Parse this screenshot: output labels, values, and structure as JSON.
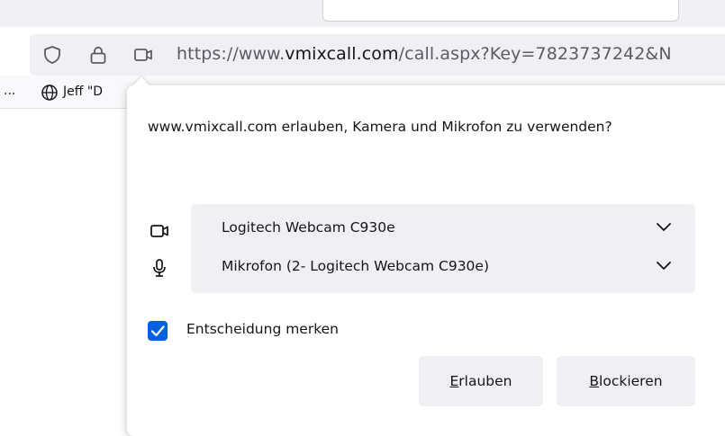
{
  "toolbar": {
    "url_prefix": "https://www.",
    "url_domain": "vmixcall.com",
    "url_suffix": "/call.aspx?Key=7823737242&N"
  },
  "bookmarks": {
    "overflow": "...",
    "item_label": "Jeff \"D"
  },
  "dialog": {
    "question": "www.vmixcall.com erlauben, Kamera und Mikrofon zu verwenden?",
    "camera_select": {
      "value": "Logitech Webcam C930e"
    },
    "microphone_select": {
      "value": "Mikrofon (2- Logitech Webcam C930e)"
    },
    "remember": {
      "label": "Entscheidung merken",
      "checked": true
    },
    "allow_button": {
      "mnemonic": "E",
      "rest": "rlauben"
    },
    "block_button": {
      "mnemonic": "B",
      "rest": "lockieren"
    }
  },
  "icons": {
    "tracking": "shield-icon",
    "secure": "lock-icon",
    "permission": "camera-icon",
    "bookmark": "globe-icon",
    "camera_device": "camera-icon",
    "mic_device": "microphone-icon",
    "dropdown": "chevron-down-icon"
  },
  "colors": {
    "accent": "#0061e0",
    "panel_bg": "#ffffff",
    "control_bg": "#f0f0f4",
    "text": "#15141a",
    "muted": "#5b5b66"
  }
}
